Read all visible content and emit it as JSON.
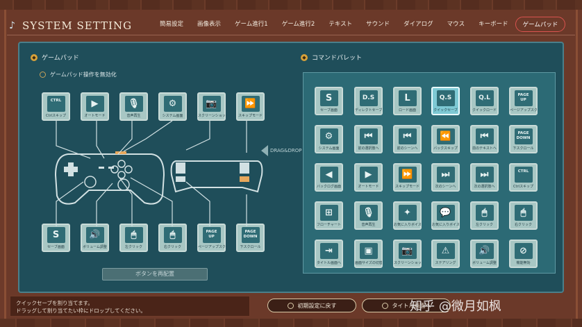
{
  "window": {
    "title": "SYSTEM SETTING"
  },
  "tabs": [
    {
      "label": "簡易設定",
      "active": false
    },
    {
      "label": "画像表示",
      "active": false
    },
    {
      "label": "ゲーム進行1",
      "active": false
    },
    {
      "label": "ゲーム進行2",
      "active": false
    },
    {
      "label": "テキスト",
      "active": false
    },
    {
      "label": "サウンド",
      "active": false
    },
    {
      "label": "ダイアログ",
      "active": false
    },
    {
      "label": "マウス",
      "active": false
    },
    {
      "label": "キーボード",
      "active": false
    },
    {
      "label": "ゲームパッド",
      "active": true
    }
  ],
  "gamepad": {
    "section_title": "ゲームパッド",
    "disable_label": "ゲームパッド操作を無効化",
    "top_buttons": [
      {
        "icon": "ctrl-icon",
        "glyph": "CTRL",
        "caption": "Ctrlスキップ"
      },
      {
        "icon": "play-icon",
        "glyph": "▶",
        "caption": "オートモード"
      },
      {
        "icon": "microphone-icon",
        "glyph": "🎙",
        "caption": "音声再生"
      },
      {
        "icon": "gear-icon",
        "glyph": "⚙",
        "caption": "システム画面"
      },
      {
        "icon": "camera-icon",
        "glyph": "📷",
        "caption": "スクリーンショット"
      },
      {
        "icon": "fast-forward-icon",
        "glyph": "⏩",
        "caption": "スキップモード"
      }
    ],
    "bottom_buttons": [
      {
        "icon": "save-icon",
        "glyph": "S",
        "caption": "セーブ画面"
      },
      {
        "icon": "speaker-icon",
        "glyph": "🔊",
        "caption": "ボリューム調整"
      },
      {
        "icon": "mouse-left-icon",
        "glyph": "🖱",
        "caption": "左クリック"
      },
      {
        "icon": "mouse-right-icon",
        "glyph": "🖱",
        "caption": "右クリック"
      },
      {
        "icon": "page-up-icon",
        "glyph": "PAGE UP",
        "caption": "ページアップスクロール"
      },
      {
        "icon": "page-down-icon",
        "glyph": "PAGE DOWN",
        "caption": "下スクロール"
      }
    ],
    "reset_button": "ボタンを再配置"
  },
  "drag_drop_label": "DRAG&DROP",
  "command_palette": {
    "section_title": "コマンドパレット",
    "rows": [
      [
        {
          "icon": "save-icon",
          "glyph": "S",
          "caption": "セーブ画面"
        },
        {
          "icon": "quick-save-icon",
          "glyph": "D.S",
          "caption": "ディレクトセーブ"
        },
        {
          "icon": "load-icon",
          "glyph": "L",
          "caption": "ロード画面"
        },
        {
          "icon": "quick-save-icon",
          "glyph": "Q.S",
          "caption": "クイックセーブ",
          "selected": true
        },
        {
          "icon": "quick-load-icon",
          "glyph": "Q.L",
          "caption": "クイックロード"
        },
        {
          "icon": "page-up-icon",
          "glyph": "PAGE UP",
          "caption": "ページアップスクロール"
        }
      ],
      [
        {
          "icon": "gear-icon",
          "glyph": "⚙",
          "caption": "システム画面"
        },
        {
          "icon": "prev-choice-icon",
          "glyph": "⏮",
          "caption": "前の選択肢へ"
        },
        {
          "icon": "prev-scene-icon",
          "glyph": "⏮",
          "caption": "前のシーンへ"
        },
        {
          "icon": "back-skip-icon",
          "glyph": "⏪",
          "caption": "バックスキップ"
        },
        {
          "icon": "prev-text-icon",
          "glyph": "⏮",
          "caption": "前のテキストへ"
        },
        {
          "icon": "page-down-icon",
          "glyph": "PAGE DOWN",
          "caption": "下スクロール"
        }
      ],
      [
        {
          "icon": "backlog-icon",
          "glyph": "◀",
          "caption": "バックログ画面"
        },
        {
          "icon": "play-icon",
          "glyph": "▶",
          "caption": "オートモード"
        },
        {
          "icon": "fast-forward-icon",
          "glyph": "⏩",
          "caption": "スキップモード"
        },
        {
          "icon": "next-scene-icon",
          "glyph": "⏭",
          "caption": "次のシーンへ"
        },
        {
          "icon": "next-choice-icon",
          "glyph": "⏭",
          "caption": "次の選択肢へ"
        },
        {
          "icon": "ctrl-icon",
          "glyph": "CTRL",
          "caption": "Ctrlスキップ"
        }
      ],
      [
        {
          "icon": "flowchart-icon",
          "glyph": "⊞",
          "caption": "フローチャート"
        },
        {
          "icon": "microphone-icon",
          "glyph": "🎙",
          "caption": "音声再生"
        },
        {
          "icon": "star-bubble-icon",
          "glyph": "✦",
          "caption": "お気に入りボイス登録"
        },
        {
          "icon": "speech-bubble-icon",
          "glyph": "💬",
          "caption": "お気に入りボイス"
        },
        {
          "icon": "mouse-left-icon",
          "glyph": "🖱",
          "caption": "左クリック"
        },
        {
          "icon": "mouse-right-icon",
          "glyph": "🖱",
          "caption": "右クリック"
        }
      ],
      [
        {
          "icon": "exit-door-icon",
          "glyph": "⇥",
          "caption": "タイトル画面へ"
        },
        {
          "icon": "window-icon",
          "glyph": "▣",
          "caption": "画面サイズの切替"
        },
        {
          "icon": "camera-icon",
          "glyph": "📷",
          "caption": "スクリーンショット"
        },
        {
          "icon": "warning-icon",
          "glyph": "⚠",
          "caption": "ステアリング"
        },
        {
          "icon": "speaker-icon",
          "glyph": "🔊",
          "caption": "ボリューム調整"
        },
        {
          "icon": "disable-icon",
          "glyph": "⊘",
          "caption": "機能無効"
        }
      ]
    ]
  },
  "bottom": {
    "info_line1": "クイックセーブを割り当てます。",
    "info_line2": "ドラッグして割り当てたい枠にドロップしてください。",
    "reset_default": "初期設定に戻す",
    "to_title": "タイトル画面へ",
    "watermark": "知乎 @微月如枫"
  },
  "colors": {
    "wood": "#6b3929",
    "panel": "#1f4e5a",
    "tile": "#a8c7c4",
    "active_tab_border": "#d9534f"
  }
}
